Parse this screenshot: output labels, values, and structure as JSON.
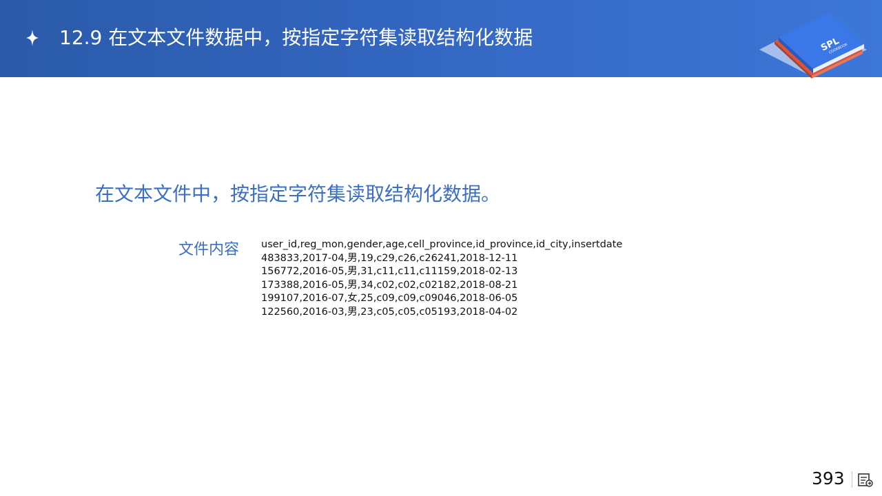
{
  "header": {
    "title": "12.9 在文本文件数据中，按指定字符集读取结构化数据",
    "star_icon": "four-point-star-icon",
    "logo": {
      "icon": "spl-cookbook-book-stack-icon",
      "text_main": "SPL",
      "text_sub": "COOKBOOK",
      "colors": {
        "top_book": "#3a78e8",
        "bottom_book": "#d8553e",
        "shadow": "#c9d7f3"
      }
    }
  },
  "main": {
    "subtitle": "在文本文件中，按指定字符集读取结构化数据。",
    "file_label": "文件内容",
    "file_lines": [
      "user_id,reg_mon,gender,age,cell_province,id_province,id_city,insertdate",
      "483833,2017-04,男,19,c29,c26,c26241,2018-12-11",
      "156772,2016-05,男,31,c11,c11,c11159,2018-02-13",
      "173388,2016-05,男,34,c02,c02,c02182,2018-08-21",
      "199107,2016-07,女,25,c09,c09,c09046,2018-06-05",
      "122560,2016-03,男,23,c05,c05,c05193,2018-04-02"
    ]
  },
  "footer": {
    "page_number": "393",
    "notes_icon": "slide-notes-icon"
  },
  "colors": {
    "header_bg": "#3366c0",
    "accent_text": "#3a6fc4"
  }
}
